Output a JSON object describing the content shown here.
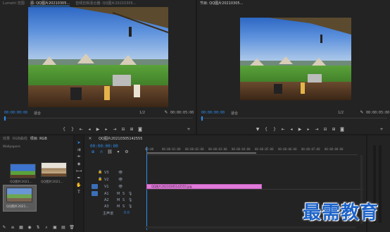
{
  "source_monitor": {
    "tabs": [
      "Lumetri 范围",
      "源: QQ图片20210305...",
      "音频剪辑混合器: QQ图片20210305..."
    ],
    "timecode_left": "00:00:00:00",
    "fit_label": "适合",
    "page_label": "1/2",
    "timecode_right": "00:00:05:00"
  },
  "program_monitor": {
    "tab": "节目: QQ图片20210305...",
    "timecode_left": "00:00:00:00",
    "fit_label": "适合",
    "page_label": "1/2",
    "timecode_right": "00:00:05:00"
  },
  "project_panel": {
    "tabs": [
      "效果",
      "RGB曲线",
      "项目: RGB"
    ],
    "search_label": "Wallpapers",
    "items": [
      {
        "label": "QQ图片2021...",
        "duration": "5:00"
      },
      {
        "label": "QQ图片2021...",
        "duration": "5:00"
      },
      {
        "label": "QQ图片2021...",
        "duration": "5:00"
      }
    ]
  },
  "timeline": {
    "tab": "QQ图片20210305142555",
    "timecode": "00:00:00:00",
    "ruler": [
      "00:00",
      "00:00:01:00",
      "00:00:02:00",
      "00:00:03:00",
      "00:00:04:00",
      "00:00:05:00",
      "00:00:06:00",
      "00:00:07:00",
      "00:00:08:00"
    ],
    "tracks": [
      {
        "id": "V3"
      },
      {
        "id": "V2"
      },
      {
        "id": "V1"
      },
      {
        "id": "A1"
      },
      {
        "id": "A2"
      },
      {
        "id": "A3"
      }
    ],
    "master_label": "主声道",
    "master_value": "0.0",
    "clip_label": "QQ图片20210305142555.jpg"
  },
  "watermark": "最需教育",
  "colors": {
    "accent": "#2d8ceb",
    "clip": "#e07ad9",
    "watermark": "#1d63c9"
  }
}
